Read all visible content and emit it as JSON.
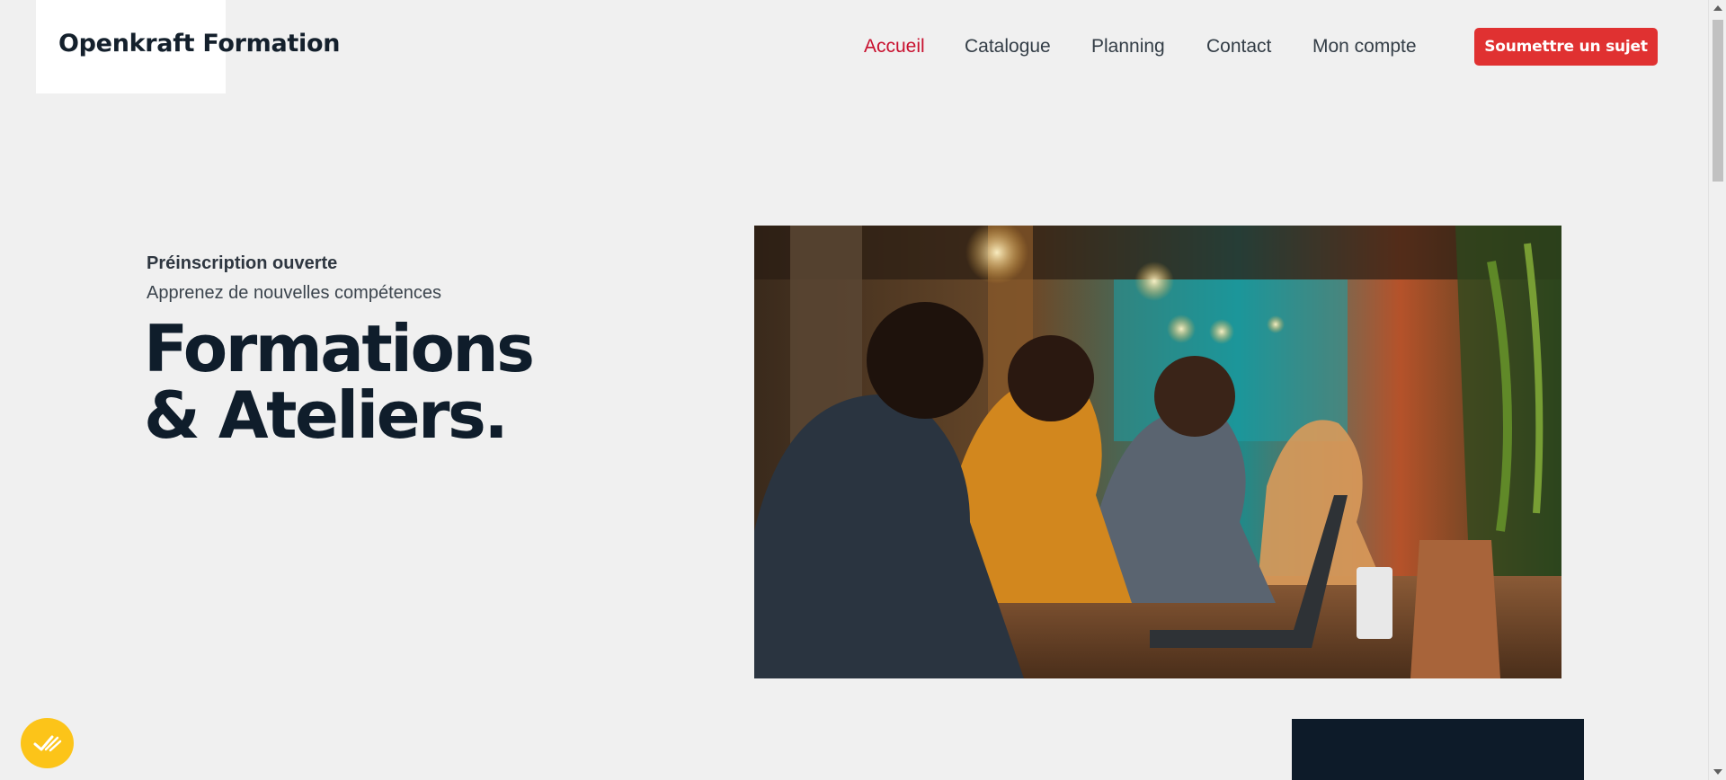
{
  "header": {
    "logo_text": "Openkraft Formation",
    "nav": [
      {
        "label": "Accueil",
        "active": true
      },
      {
        "label": "Catalogue",
        "active": false
      },
      {
        "label": "Planning",
        "active": false
      },
      {
        "label": "Contact",
        "active": false
      },
      {
        "label": "Mon compte",
        "active": false
      }
    ],
    "cta_label": "Soumettre un sujet"
  },
  "hero": {
    "eyebrow": "Préinscription ouverte",
    "subtitle": "Apprenez de nouvelles compétences",
    "headline_line1": "Formations",
    "headline_line2": "& Ateliers."
  },
  "icons": {
    "badge": "checkmarks-icon",
    "scroll_up": "chevron-up-icon",
    "scroll_down": "chevron-down-icon"
  },
  "colors": {
    "background": "#f0f0f0",
    "accent": "#c8102e",
    "cta": "#e03131",
    "headline": "#0f1d2b",
    "badge": "#fcc419",
    "dark_block": "#0d1b29"
  }
}
